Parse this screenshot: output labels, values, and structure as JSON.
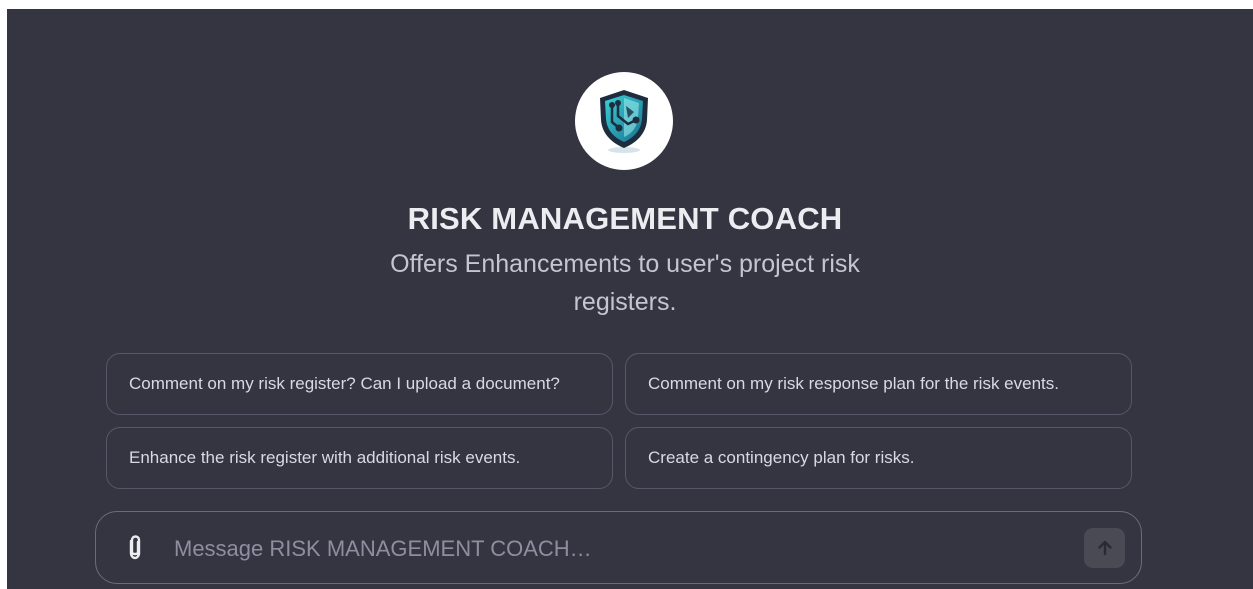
{
  "gpt": {
    "name": "RISK MANAGEMENT COACH",
    "description": "Offers Enhancements to user's project risk registers.",
    "avatar_icon": "shield-circuit-icon"
  },
  "suggestions": [
    "Comment on my risk register? Can I upload a document?",
    "Comment on my risk response plan for the risk events.",
    "Enhance the risk register with additional risk events.",
    "Create a contingency plan for risks."
  ],
  "composer": {
    "placeholder": "Message RISK MANAGEMENT COACH…",
    "attach_icon": "paperclip-icon",
    "send_icon": "arrow-up-icon"
  },
  "colors": {
    "background": "#343541",
    "text_primary": "#ececf1",
    "text_secondary": "#c5c5d2",
    "border": "#565869",
    "accent": "#2bb3c0"
  }
}
